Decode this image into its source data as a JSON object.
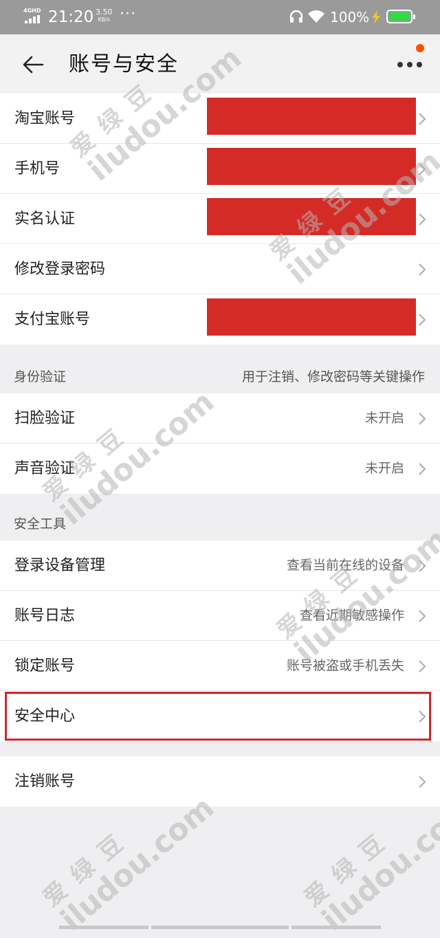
{
  "status_bar": {
    "network": "4GHD",
    "time": "21:20",
    "speed_value": "3.50",
    "speed_unit": "KB/s",
    "dots": "···",
    "battery_percent": "100%",
    "battery_color": "#2fdc43"
  },
  "header": {
    "title": "账号与安全",
    "badge_color": "#ff5000"
  },
  "group_account": {
    "items": [
      {
        "label": "淘宝账号",
        "redacted": true
      },
      {
        "label": "手机号",
        "redacted": true
      },
      {
        "label": "实名认证",
        "redacted": true
      },
      {
        "label": "修改登录密码",
        "redacted": false
      },
      {
        "label": "支付宝账号",
        "redacted": true
      }
    ]
  },
  "section_identity": {
    "title": "身份验证",
    "note": "用于注销、修改密码等关键操作",
    "items": [
      {
        "label": "扫脸验证",
        "value": "未开启"
      },
      {
        "label": "声音验证",
        "value": "未开启"
      }
    ]
  },
  "section_tools": {
    "title": "安全工具",
    "items": [
      {
        "label": "登录设备管理",
        "value": "查看当前在线的设备"
      },
      {
        "label": "账号日志",
        "value": "查看近期敏感操作"
      },
      {
        "label": "锁定账号",
        "value": "账号被盗或手机丢失"
      },
      {
        "label": "安全中心",
        "value": ""
      }
    ]
  },
  "group_cancel": {
    "items": [
      {
        "label": "注销账号"
      }
    ]
  },
  "watermark": {
    "cn": "爱绿豆",
    "en": "iludou.com"
  },
  "colors": {
    "redaction": "#d52b27",
    "highlight_border": "#d0262a"
  }
}
